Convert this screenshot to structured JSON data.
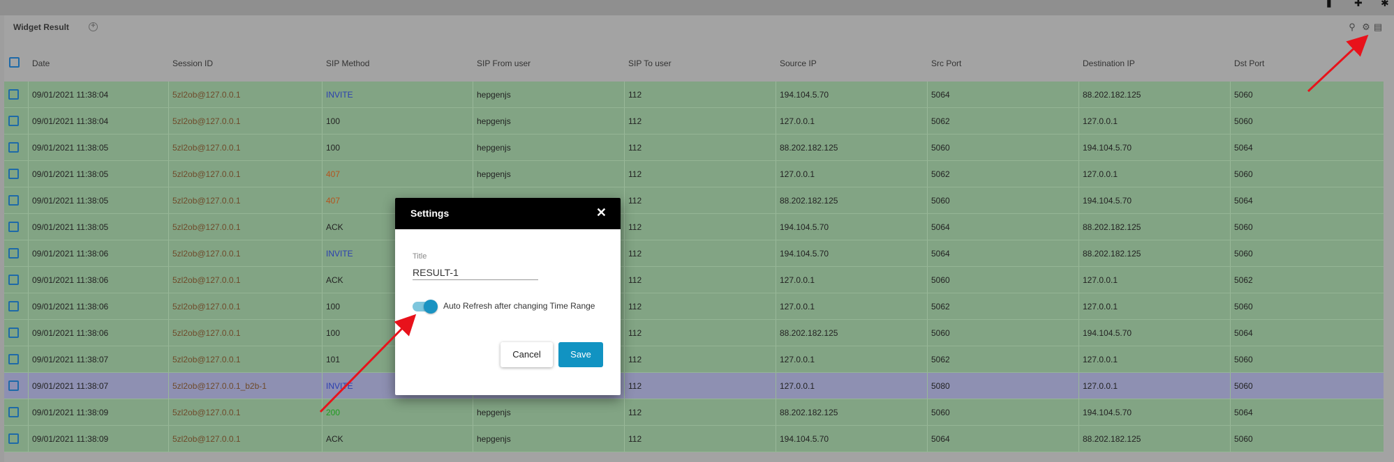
{
  "topbar": {
    "icons": [
      "save-icon",
      "plus-icon",
      "settings-icon"
    ]
  },
  "widget": {
    "title": "Widget Result",
    "header_icons": [
      "search-icon",
      "gear-icon",
      "trash-icon"
    ]
  },
  "table": {
    "columns": [
      "Date",
      "Session ID",
      "SIP Method",
      "SIP From user",
      "SIP To user",
      "Source IP",
      "Src Port",
      "Destination IP",
      "Dst Port"
    ],
    "rows": [
      [
        "09/01/2021 11:38:04",
        "5zl2ob@127.0.0.1",
        "INVITE",
        "hepgenjs",
        "112",
        "194.104.5.70",
        "5064",
        "88.202.182.125",
        "5060"
      ],
      [
        "09/01/2021 11:38:04",
        "5zl2ob@127.0.0.1",
        "100",
        "hepgenjs",
        "112",
        "127.0.0.1",
        "5062",
        "127.0.0.1",
        "5060"
      ],
      [
        "09/01/2021 11:38:05",
        "5zl2ob@127.0.0.1",
        "100",
        "hepgenjs",
        "112",
        "88.202.182.125",
        "5060",
        "194.104.5.70",
        "5064"
      ],
      [
        "09/01/2021 11:38:05",
        "5zl2ob@127.0.0.1",
        "407",
        "hepgenjs",
        "112",
        "127.0.0.1",
        "5062",
        "127.0.0.1",
        "5060"
      ],
      [
        "09/01/2021 11:38:05",
        "5zl2ob@127.0.0.1",
        "407",
        "",
        "112",
        "88.202.182.125",
        "5060",
        "194.104.5.70",
        "5064"
      ],
      [
        "09/01/2021 11:38:05",
        "5zl2ob@127.0.0.1",
        "ACK",
        "",
        "112",
        "194.104.5.70",
        "5064",
        "88.202.182.125",
        "5060"
      ],
      [
        "09/01/2021 11:38:06",
        "5zl2ob@127.0.0.1",
        "INVITE",
        "",
        "112",
        "194.104.5.70",
        "5064",
        "88.202.182.125",
        "5060"
      ],
      [
        "09/01/2021 11:38:06",
        "5zl2ob@127.0.0.1",
        "ACK",
        "",
        "112",
        "127.0.0.1",
        "5060",
        "127.0.0.1",
        "5062"
      ],
      [
        "09/01/2021 11:38:06",
        "5zl2ob@127.0.0.1",
        "100",
        "",
        "112",
        "127.0.0.1",
        "5062",
        "127.0.0.1",
        "5060"
      ],
      [
        "09/01/2021 11:38:06",
        "5zl2ob@127.0.0.1",
        "100",
        "",
        "112",
        "88.202.182.125",
        "5060",
        "194.104.5.70",
        "5064"
      ],
      [
        "09/01/2021 11:38:07",
        "5zl2ob@127.0.0.1",
        "101",
        "",
        "112",
        "127.0.0.1",
        "5062",
        "127.0.0.1",
        "5060"
      ],
      [
        "09/01/2021 11:38:07",
        "5zl2ob@127.0.0.1_b2b-1",
        "INVITE",
        "",
        "112",
        "127.0.0.1",
        "5080",
        "127.0.0.1",
        "5060"
      ],
      [
        "09/01/2021 11:38:09",
        "5zl2ob@127.0.0.1",
        "200",
        "hepgenjs",
        "112",
        "88.202.182.125",
        "5060",
        "194.104.5.70",
        "5064"
      ],
      [
        "09/01/2021 11:38:09",
        "5zl2ob@127.0.0.1",
        "ACK",
        "hepgenjs",
        "112",
        "194.104.5.70",
        "5064",
        "88.202.182.125",
        "5060"
      ]
    ],
    "selected_row": 11
  },
  "dialog": {
    "title": "Settings",
    "close_icon": "close-icon",
    "title_field_label": "Title",
    "title_field_value": "RESULT-1",
    "auto_refresh_label": "Auto Refresh after changing Time Range",
    "auto_refresh_on": true,
    "cancel_label": "Cancel",
    "save_label": "Save"
  },
  "colors": {
    "row_green": "#82a484",
    "row_selected": "#8e90b2",
    "accent": "#1193c2",
    "annotation_arrow": "#e8121b"
  }
}
